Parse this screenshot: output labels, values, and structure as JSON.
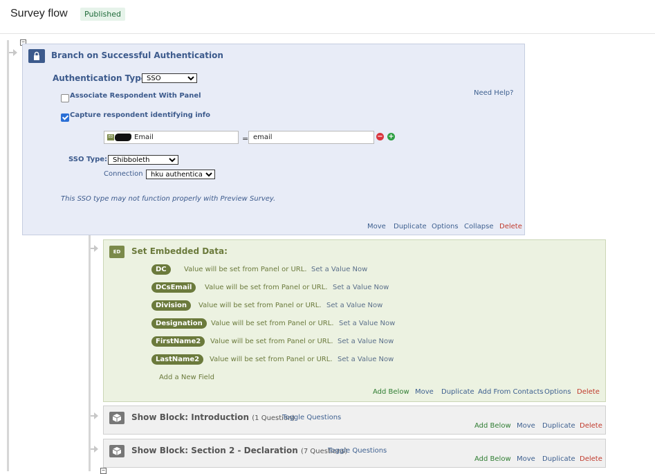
{
  "header": {
    "title": "Survey flow",
    "status": "Published"
  },
  "auth_branch": {
    "title": "Branch on Successful Authentication",
    "auth_type_label": "Authentication Type:",
    "auth_type_value": "SSO",
    "associate_label": "Associate Respondent With Panel",
    "associate_checked": false,
    "capture_label": "Capture respondent identifying info",
    "capture_checked": true,
    "need_help": "Need Help?",
    "left_field": "Email",
    "equals": "=",
    "right_field": "email",
    "sso_type_label": "SSO Type:",
    "sso_type_value": "Shibboleth",
    "connection_label": "Connection",
    "connection_value": "hku authenticator",
    "note": "This SSO type may not function properly with Preview Survey.",
    "actions": {
      "move": "Move",
      "duplicate": "Duplicate",
      "options": "Options",
      "collapse": "Collapse",
      "delete": "Delete"
    }
  },
  "embedded_data": {
    "icon_text": "ED",
    "title": "Set Embedded Data:",
    "fields": [
      {
        "name": "DC",
        "text": "Value will be set from Panel or URL.",
        "link": "Set a Value Now"
      },
      {
        "name": "DCsEmail",
        "text": "Value will be set from Panel or URL.",
        "link": "Set a Value Now"
      },
      {
        "name": "Division",
        "text": "Value will be set from Panel or URL.",
        "link": "Set a Value Now"
      },
      {
        "name": "Designation",
        "text": "Value will be set from Panel or URL.",
        "link": "Set a Value Now"
      },
      {
        "name": "FirstName2",
        "text": "Value will be set from Panel or URL.",
        "link": "Set a Value Now"
      },
      {
        "name": "LastName2",
        "text": "Value will be set from Panel or URL.",
        "link": "Set a Value Now"
      }
    ],
    "add_field": "Add a New Field",
    "actions": {
      "add_below": "Add Below",
      "move": "Move",
      "duplicate": "Duplicate",
      "add_from_contacts": "Add From Contacts",
      "options": "Options",
      "delete": "Delete"
    }
  },
  "blocks": [
    {
      "title": "Show Block: Introduction",
      "count": "(1 Question)",
      "toggle": "Toggle Questions",
      "actions": {
        "add_below": "Add Below",
        "move": "Move",
        "duplicate": "Duplicate",
        "delete": "Delete"
      }
    },
    {
      "title": "Show Block: Section 2 - Declaration",
      "count": "(7 Questions)",
      "toggle": "Toggle Questions",
      "actions": {
        "add_below": "Add Below",
        "move": "Move",
        "duplicate": "Duplicate",
        "delete": "Delete"
      }
    }
  ],
  "colors": {
    "auth_bg": "#e8ecf7",
    "auth_accent": "#3c5a8c",
    "ed_bg": "#ecf2e1",
    "ed_accent": "#6b7a3c",
    "block_bg": "#f0f0f0",
    "delete": "#c0392b",
    "add_below": "#2f7d32"
  },
  "icons": {
    "auth": "lock-icon",
    "ed": "embedded-data-icon",
    "block": "block-cube-icon",
    "remove": "minus-circle-icon",
    "add": "plus-circle-icon"
  }
}
